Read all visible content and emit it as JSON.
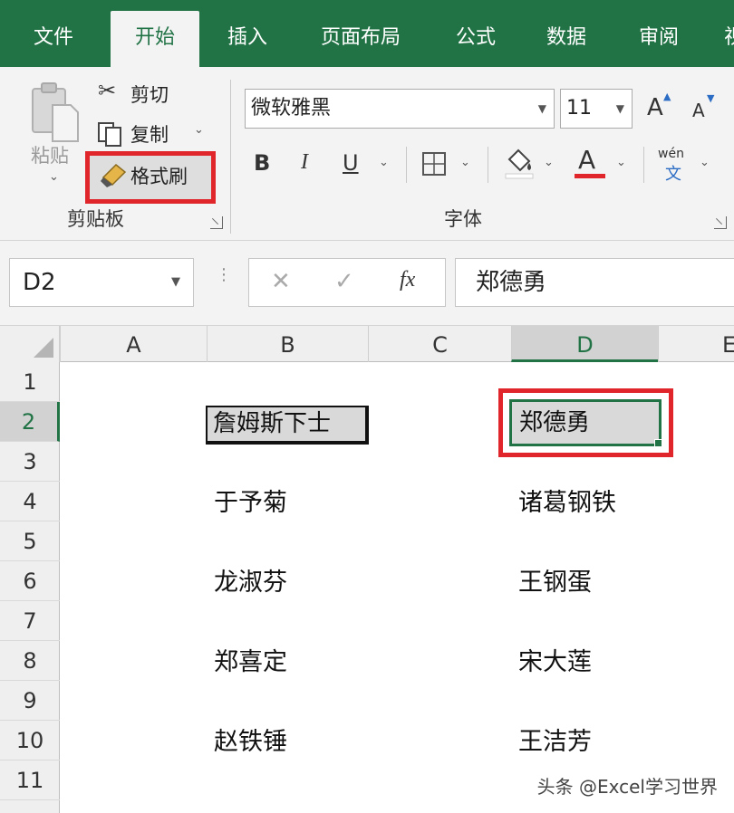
{
  "tabs": [
    "文件",
    "开始",
    "插入",
    "页面布局",
    "公式",
    "数据",
    "审阅",
    "视"
  ],
  "active_tab": "开始",
  "accent_color": "#217346",
  "highlight_color": "#e0262a",
  "clipboard": {
    "paste_label": "粘贴",
    "cut_label": "剪切",
    "copy_label": "复制",
    "format_painter_label": "格式刷",
    "group_label": "剪贴板"
  },
  "font": {
    "font_name": "微软雅黑",
    "font_size": "11",
    "bold": "B",
    "italic": "I",
    "underline": "U",
    "font_color_glyph": "A",
    "phonetic_top": "wén",
    "phonetic_bottom": "文",
    "group_label": "字体",
    "grow_glyph": "A",
    "shrink_glyph": "A"
  },
  "formula_bar": {
    "name_box": "D2",
    "fx_label": "fx",
    "formula": "郑德勇"
  },
  "columns": [
    "A",
    "B",
    "C",
    "D",
    "E"
  ],
  "selected_column": "D",
  "rows": [
    "1",
    "2",
    "3",
    "4",
    "5",
    "6",
    "7",
    "8",
    "9",
    "10",
    "11"
  ],
  "selected_row": "2",
  "cells": {
    "B2": "詹姆斯下士",
    "D2": "郑德勇",
    "B4": "于予菊",
    "D4": "诸葛钢铁",
    "B6": "龙淑芬",
    "D6": "王钢蛋",
    "B8": "郑喜定",
    "D8": "宋大莲",
    "B10": "赵铁锤",
    "D10": "王洁芳"
  },
  "watermark": "头条 @Excel学习世界"
}
